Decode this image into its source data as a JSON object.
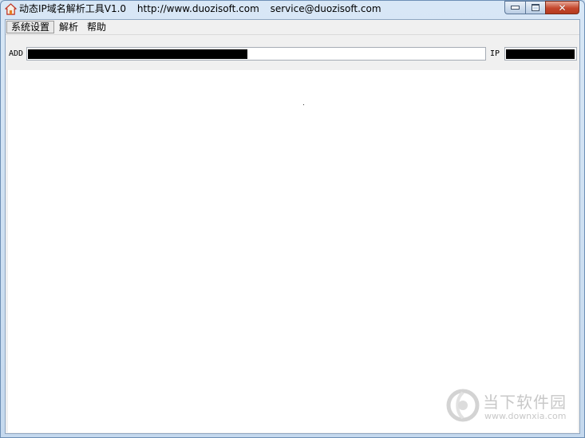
{
  "window": {
    "title_parts": [
      "动态IP域名解析工具V1.0",
      "http://www.duozisoft.com",
      "service@duozisoft.com"
    ],
    "controls": {
      "minimize_icon": "minimize-icon",
      "maximize_icon": "maximize-icon",
      "close_icon": "close-icon",
      "close_glyph": "✕"
    }
  },
  "menu": {
    "items": [
      {
        "label": "系统设置",
        "active": true
      },
      {
        "label": "解析",
        "active": false
      },
      {
        "label": "帮助",
        "active": false
      }
    ]
  },
  "address_bar": {
    "add_label": "ADD",
    "add_value": "",
    "ip_label": "IP",
    "ip_value": ""
  },
  "watermark": {
    "title": "当下软件园",
    "url": "www.downxia.com"
  },
  "colors": {
    "titlebar": "#c5d9ee",
    "client_bg": "#f0f0f0",
    "close_button": "#c4462c",
    "redaction": "#000000",
    "watermark": "#c8c8c8"
  }
}
